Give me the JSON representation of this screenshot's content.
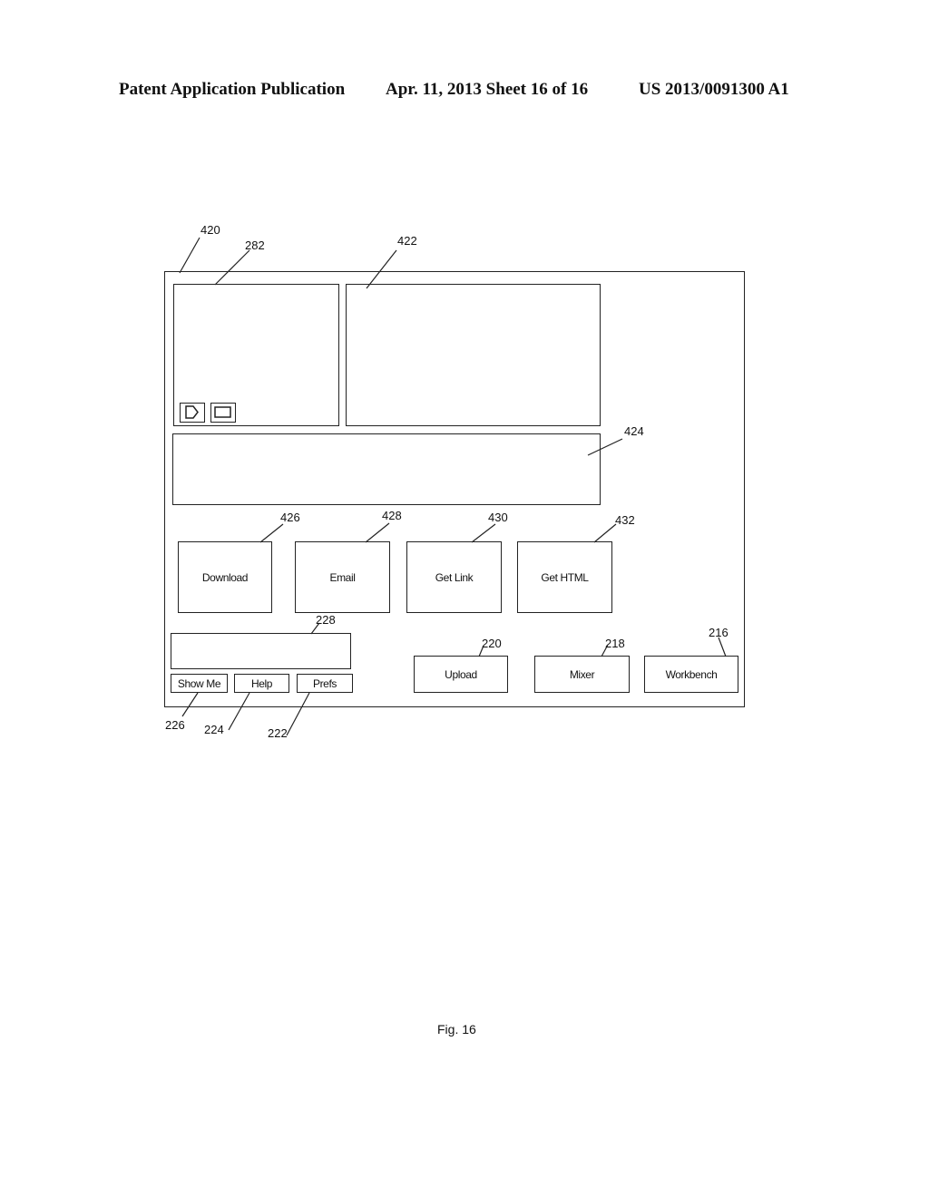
{
  "header": {
    "left": "Patent Application Publication",
    "center": "Apr. 11, 2013  Sheet 16 of 16",
    "right": "US 2013/0091300 A1"
  },
  "refs": {
    "window": "420",
    "player": "282",
    "preview": "422",
    "text_area": "424",
    "download": "426",
    "email": "428",
    "get_link": "430",
    "get_html": "432",
    "input_box": "228",
    "upload": "220",
    "mixer": "218",
    "workbench": "216",
    "show_me": "226",
    "help": "224",
    "prefs": "222"
  },
  "buttons": {
    "download": "Download",
    "email": "Email",
    "get_link": "Get Link",
    "get_html": "Get HTML",
    "show_me": "Show Me",
    "help": "Help",
    "prefs": "Prefs",
    "upload": "Upload",
    "mixer": "Mixer",
    "workbench": "Workbench"
  },
  "player_controls": [
    "play-icon",
    "stop-icon"
  ],
  "figure_label": "Fig. 16"
}
